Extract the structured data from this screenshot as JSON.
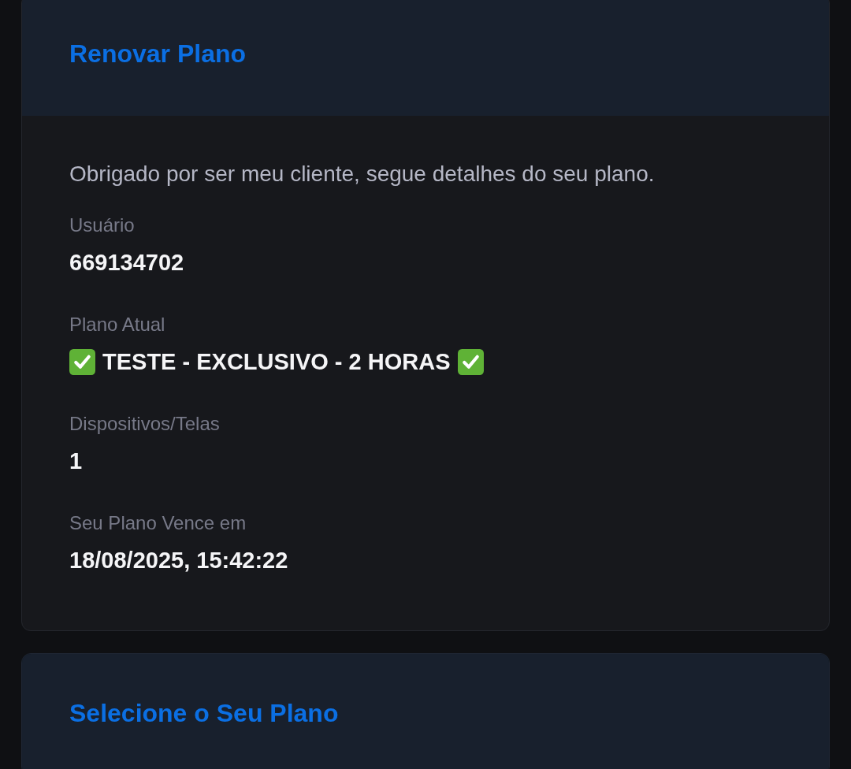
{
  "cards": [
    {
      "title": "Renovar Plano",
      "intro": "Obrigado por ser meu cliente, segue detalhes do seu plano.",
      "fields": [
        {
          "label": "Usuário",
          "value": "669134702",
          "check_before": false,
          "check_after": false
        },
        {
          "label": "Plano Atual",
          "value": "TESTE - EXCLUSIVO - 2 HORAS",
          "check_before": true,
          "check_after": true
        },
        {
          "label": "Dispositivos/Telas",
          "value": "1",
          "check_before": false,
          "check_after": false
        },
        {
          "label": "Seu Plano Vence em",
          "value": "18/08/2025, 15:42:22",
          "check_before": false,
          "check_after": false
        }
      ]
    },
    {
      "title": "Selecione o Seu Plano"
    }
  ]
}
